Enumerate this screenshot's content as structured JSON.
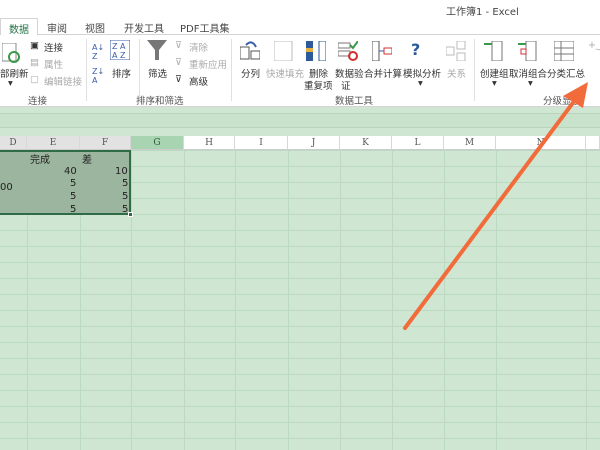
{
  "window": {
    "title": "工作簿1 - Excel"
  },
  "tabs": [
    "数据",
    "审阅",
    "视图",
    "开发工具",
    "PDF工具集"
  ],
  "ribbon": {
    "connections": {
      "refresh_all": "部刷新",
      "connect": "连接",
      "properties": "属性",
      "edit_links": "编辑链接",
      "group_label": "连接"
    },
    "sort_filter": {
      "sort": "排序",
      "filter": "筛选",
      "clear": "清除",
      "reapply": "重新应用",
      "advanced": "高级",
      "group_label": "排序和筛选"
    },
    "data_tools": {
      "text_to_columns": "分列",
      "flash_fill": "快速填充",
      "remove_dup_1": "删除",
      "remove_dup_2": "重复项",
      "validation_1": "数据验",
      "validation_2": "证",
      "consolidate": "合并计算",
      "what_if": "模拟分析",
      "relationships": "关系",
      "group_label": "数据工具"
    },
    "outline": {
      "group": "创建组",
      "ungroup": "取消组合",
      "subtotal": "分类汇总",
      "group_label": "分级显示"
    }
  },
  "columns": [
    "D",
    "E",
    "F",
    "G",
    "H",
    "I",
    "J",
    "K",
    "L",
    "M",
    "N"
  ],
  "cells": {
    "e1": "完成",
    "f1": "差",
    "e2": "40",
    "f2": "10",
    "d3": "00",
    "e3": "5",
    "f3": "5",
    "e4": "5",
    "f4": "5",
    "e5": "5",
    "f5": "5"
  },
  "colors": {
    "accent": "#217346",
    "arrow": "#f26b3a"
  }
}
